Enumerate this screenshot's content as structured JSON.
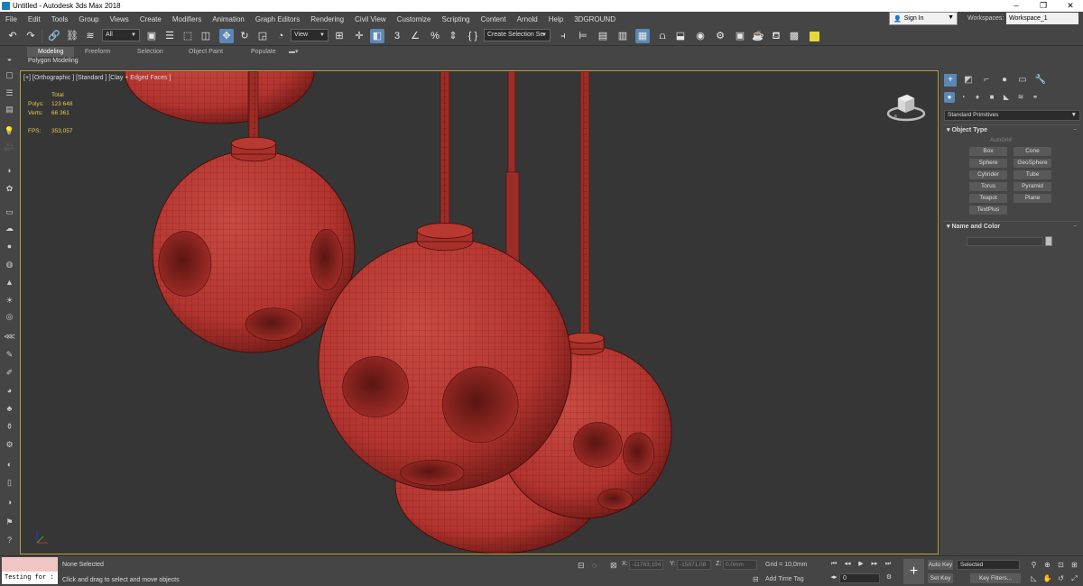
{
  "app": {
    "title": "Untitled - Autodesk 3ds Max 2018"
  },
  "window_controls": {
    "minimize": "–",
    "maximize": "❐",
    "close": "✕"
  },
  "menu": [
    "File",
    "Edit",
    "Tools",
    "Group",
    "Views",
    "Create",
    "Modifiers",
    "Animation",
    "Graph Editors",
    "Rendering",
    "Civil View",
    "Customize",
    "Scripting",
    "Content",
    "Arnold",
    "Help",
    "3DGROUND"
  ],
  "account": {
    "sign_in": "Sign In",
    "workspaces_label": "Workspaces:",
    "workspace": "Workspace_1"
  },
  "toolbar": {
    "filter": "All",
    "ref_coord": "View",
    "selection_set": "Create Selection Se",
    "snap_label": "3",
    "angle_snap": "%"
  },
  "ribbon": {
    "tabs": [
      "Modeling",
      "Freeform",
      "Selection",
      "Object Paint",
      "Populate"
    ],
    "active_tab": "Modeling",
    "sub": "Polygon Modeling"
  },
  "viewport": {
    "label": "[+] [Orthographic ] [Standard ] [Clay + Edged Faces ]",
    "stats": {
      "header": "Total",
      "polys_label": "Polys:",
      "polys": "123 648",
      "verts_label": "Verts:",
      "verts": "66 361",
      "fps_label": "FPS:",
      "fps": "353,057"
    },
    "mesh_color": "#b3342f",
    "bg_color": "#363636"
  },
  "command_panel": {
    "category": "Standard Primitives",
    "object_type_header": "Object Type",
    "autogrid": "AutoGrid",
    "primitives": [
      "Box",
      "Cone",
      "Sphere",
      "GeoSphere",
      "Cylinder",
      "Tube",
      "Torus",
      "Pyramid",
      "Teapot",
      "Plane",
      "TextPlus"
    ],
    "name_color_header": "Name and Color",
    "collapse_glyph": "−"
  },
  "status": {
    "listener_text": "Testing for :",
    "selected": "None Selected",
    "prompt": "Click and drag to select and move objects",
    "x_label": "X:",
    "x": "-11763,194",
    "y_label": "Y:",
    "y": "-15871,08",
    "z_label": "Z:",
    "z": "0,0mm",
    "grid": "Grid = 10,0mm",
    "add_time_tag": "Add Time Tag",
    "frame": "0",
    "auto_key": "Auto Key",
    "set_key": "Set Key",
    "selected_set": "Selected",
    "key_filters": "Key Filters..."
  }
}
